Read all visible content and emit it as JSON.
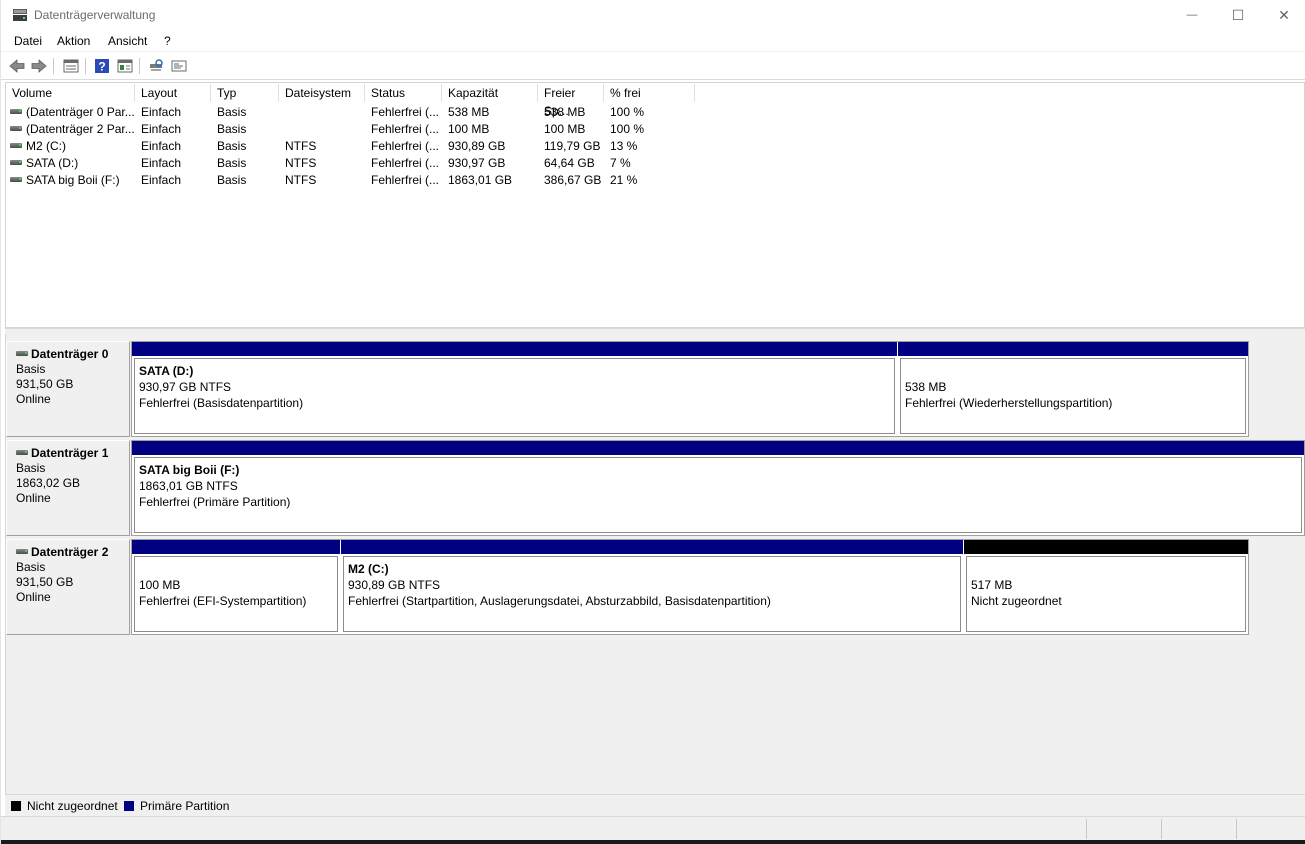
{
  "window": {
    "title": "Datenträgerverwaltung",
    "controls": {
      "minimize": "—",
      "maximize": "☐",
      "close": "✕"
    }
  },
  "menu": [
    "Datei",
    "Aktion",
    "Ansicht",
    "?"
  ],
  "toolbar": {
    "icons": [
      "back-icon",
      "forward-icon",
      "disk-list-icon",
      "help-icon",
      "properties-icon",
      "rescan-icon",
      "settings-icon"
    ]
  },
  "volume_list": {
    "columns": [
      "Volume",
      "Layout",
      "Typ",
      "Dateisystem",
      "Status",
      "Kapazität",
      "Freier Sp...",
      "% frei"
    ],
    "rows": [
      {
        "volume": "(Datenträger 0 Par...",
        "layout": "Einfach",
        "typ": "Basis",
        "fs": "",
        "status": "Fehlerfrei (...",
        "capacity": "538 MB",
        "free": "538 MB",
        "pct": "100 %"
      },
      {
        "volume": "(Datenträger 2 Par...",
        "layout": "Einfach",
        "typ": "Basis",
        "fs": "",
        "status": "Fehlerfrei (...",
        "capacity": "100 MB",
        "free": "100 MB",
        "pct": "100 %"
      },
      {
        "volume": "M2 (C:)",
        "layout": "Einfach",
        "typ": "Basis",
        "fs": "NTFS",
        "status": "Fehlerfrei (...",
        "capacity": "930,89 GB",
        "free": "119,79 GB",
        "pct": "13 %"
      },
      {
        "volume": "SATA (D:)",
        "layout": "Einfach",
        "typ": "Basis",
        "fs": "NTFS",
        "status": "Fehlerfrei (...",
        "capacity": "930,97 GB",
        "free": "64,64 GB",
        "pct": "7 %"
      },
      {
        "volume": "SATA big Boii (F:)",
        "layout": "Einfach",
        "typ": "Basis",
        "fs": "NTFS",
        "status": "Fehlerfrei (...",
        "capacity": "1863,01 GB",
        "free": "386,67 GB",
        "pct": "21 %"
      }
    ]
  },
  "disks": [
    {
      "name": "Datenträger 0",
      "type": "Basis",
      "size": "931,50 GB",
      "state": "Online",
      "partitions": [
        {
          "title": "SATA  (D:)",
          "line1": "930,97 GB NTFS",
          "line2": "Fehlerfrei (Basisdatenpartition)",
          "kind": "primary"
        },
        {
          "title": "",
          "line1": "538 MB",
          "line2": "Fehlerfrei (Wiederherstellungspartition)",
          "kind": "primary"
        }
      ]
    },
    {
      "name": "Datenträger 1",
      "type": "Basis",
      "size": "1863,02 GB",
      "state": "Online",
      "partitions": [
        {
          "title": "SATA big Boii  (F:)",
          "line1": "1863,01 GB NTFS",
          "line2": "Fehlerfrei (Primäre Partition)",
          "kind": "primary"
        }
      ]
    },
    {
      "name": "Datenträger 2",
      "type": "Basis",
      "size": "931,50 GB",
      "state": "Online",
      "partitions": [
        {
          "title": "",
          "line1": "100 MB",
          "line2": "Fehlerfrei (EFI-Systempartition)",
          "kind": "primary"
        },
        {
          "title": "M2  (C:)",
          "line1": "930,89 GB NTFS",
          "line2": "Fehlerfrei (Startpartition, Auslagerungsdatei, Absturzabbild, Basisdatenpartition)",
          "kind": "primary"
        },
        {
          "title": "",
          "line1": "517 MB",
          "line2": "Nicht zugeordnet",
          "kind": "unallocated"
        }
      ]
    }
  ],
  "legend": [
    {
      "label": "Nicht zugeordnet",
      "color": "#000000"
    },
    {
      "label": "Primäre Partition",
      "color": "#000080"
    }
  ],
  "colors": {
    "primary": "#000080",
    "unallocated": "#000000"
  }
}
